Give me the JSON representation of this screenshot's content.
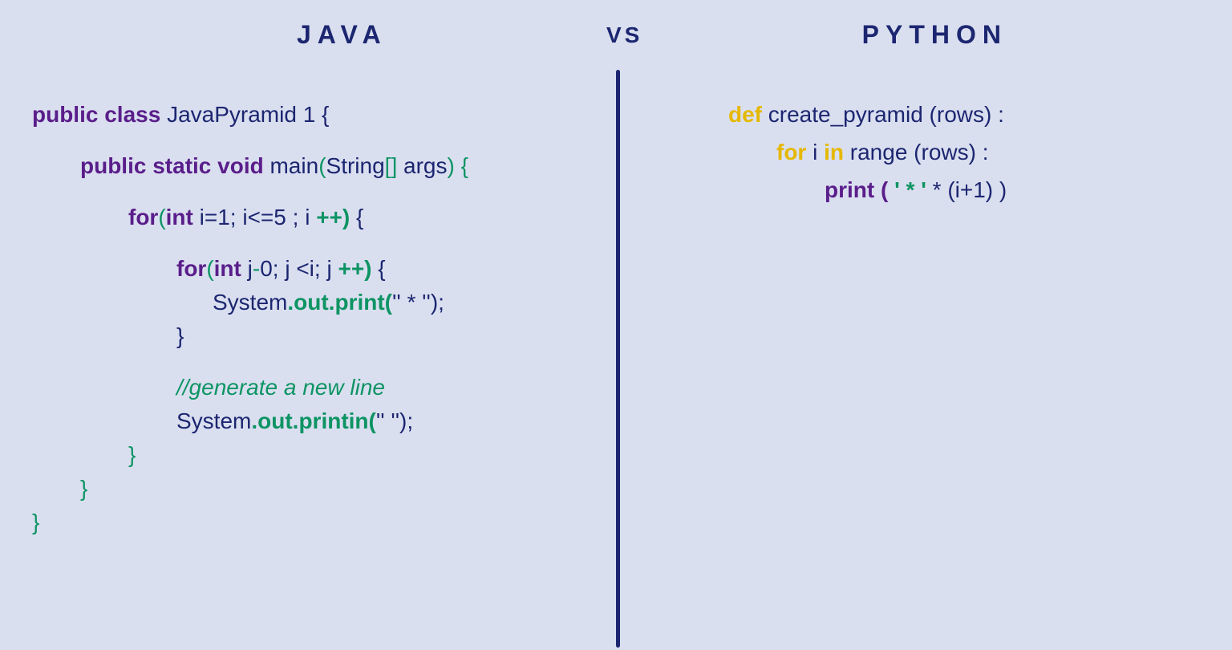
{
  "header": {
    "java_title": "JAVA",
    "vs": "VS",
    "python_title": "PYTHON"
  },
  "java": {
    "l1_a": "public class ",
    "l1_b": "JavaPyramid 1 {",
    "l2_a": "public static void ",
    "l2_b": "main",
    "l2_c": "(",
    "l2_d": "String",
    "l2_e": "[]",
    "l2_f": " args",
    "l2_g": ") {",
    "l3_a": "for",
    "l3_b": "(",
    "l3_c": "int",
    "l3_d": " i=1; i<=5",
    "l3_e": " ; i",
    "l3_f": " ++) ",
    "l3_g": "{",
    "l4_a": "for",
    "l4_b": "(",
    "l4_c": "int",
    "l4_d": " j",
    "l4_e": "-",
    "l4_f": "0; j <i; j",
    "l4_g": " ++) ",
    "l4_h": "{",
    "l5_a": "System",
    "l5_b": ".out.print(",
    "l5_c": "'' * '');",
    "l6": "}",
    "l7": "//generate a new line",
    "l8_a": "System",
    "l8_b": ".out.printin(",
    "l8_c": "''  '');",
    "l9": "}",
    "l10": "}",
    "l11": "}"
  },
  "python": {
    "l1_a": "def ",
    "l1_b": "create_pyramid (rows) :",
    "l2_a": "for ",
    "l2_b": "i ",
    "l2_c": "in ",
    "l2_d": "range (rows) :",
    "l3_a": "print ( ",
    "l3_b": "' * ' ",
    "l3_c": "* (i+1) )"
  }
}
